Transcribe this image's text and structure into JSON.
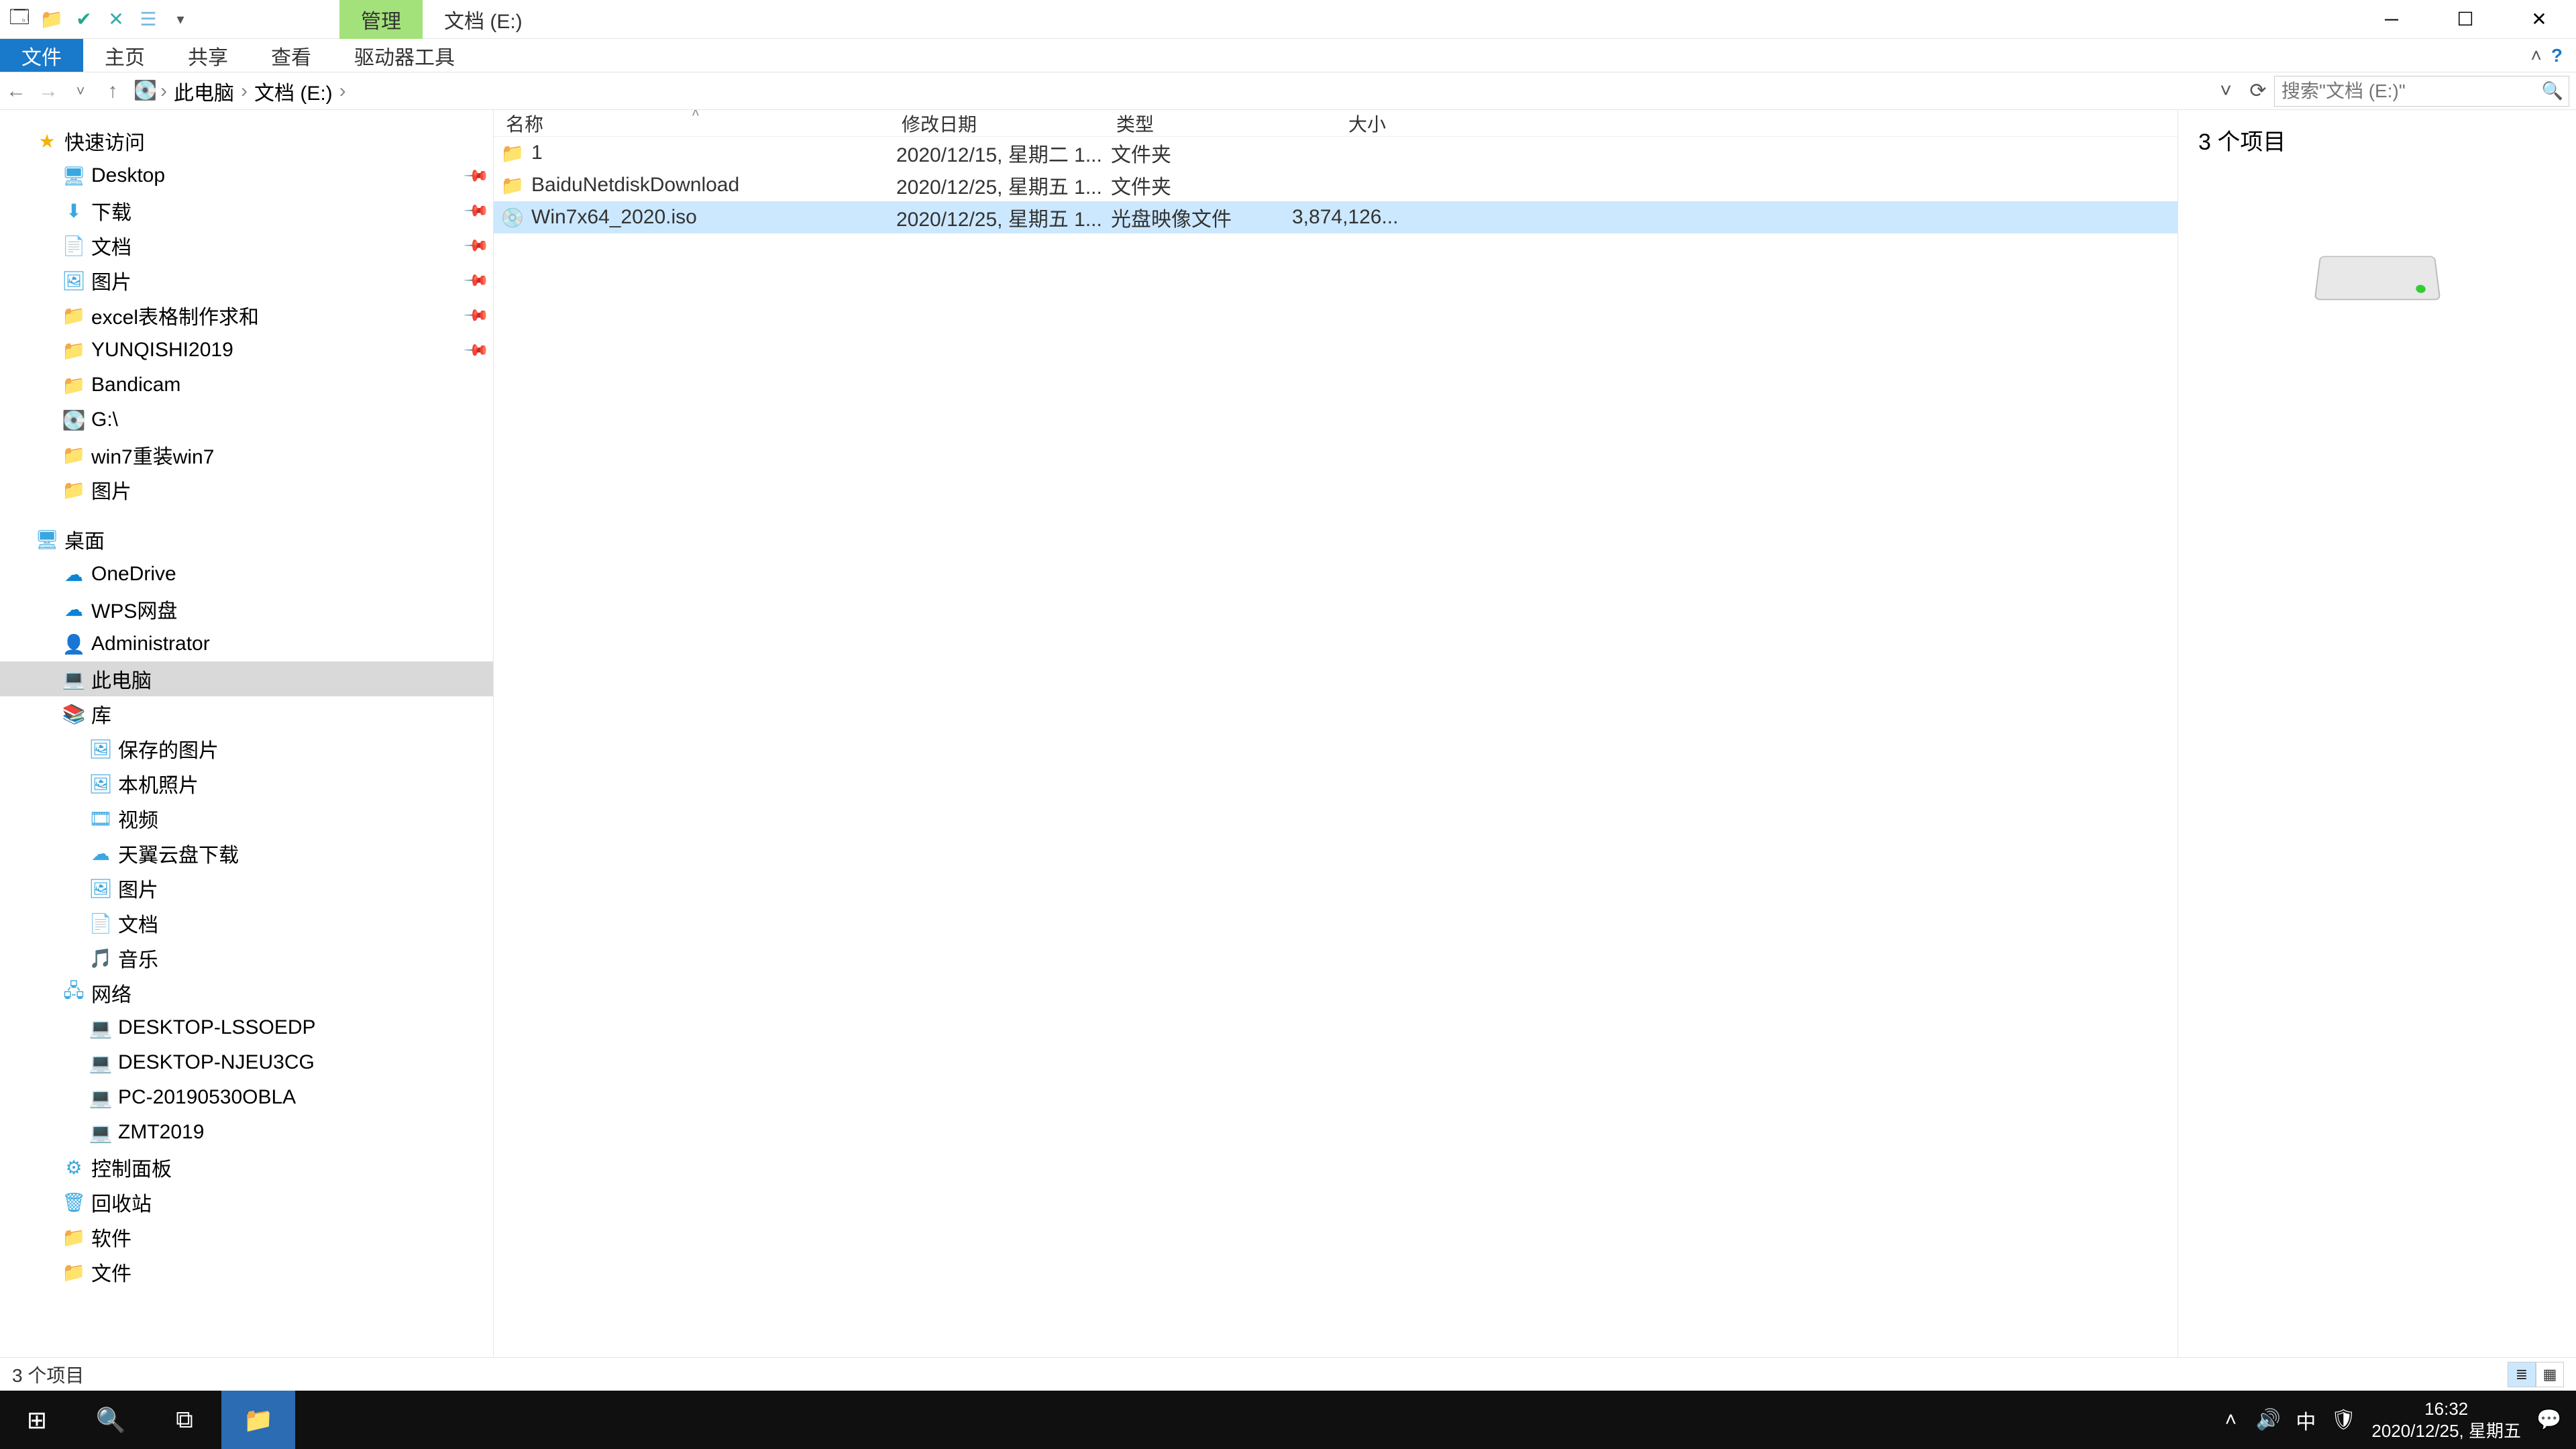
{
  "title_ctx_tab": "管理",
  "title_path_tab": "文档 (E:)",
  "ribbon": {
    "file": "文件",
    "home": "主页",
    "share": "共享",
    "view": "查看",
    "drive_tools": "驱动器工具"
  },
  "addr": {
    "c1": "此电脑",
    "c2": "文档 (E:)",
    "sep": "›",
    "search_placeholder": "搜索\"文档 (E:)\""
  },
  "cols": {
    "name": "名称",
    "date": "修改日期",
    "type": "类型",
    "size": "大小"
  },
  "files": [
    {
      "name": "1",
      "date": "2020/12/15, 星期二 1...",
      "type": "文件夹",
      "size": ""
    },
    {
      "name": "BaiduNetdiskDownload",
      "date": "2020/12/25, 星期五 1...",
      "type": "文件夹",
      "size": ""
    },
    {
      "name": "Win7x64_2020.iso",
      "date": "2020/12/25, 星期五 1...",
      "type": "光盘映像文件",
      "size": "3,874,126..."
    }
  ],
  "tree": {
    "quick": "快速访问",
    "quick_items": [
      "Desktop",
      "下载",
      "文档",
      "图片",
      "excel表格制作求和",
      "YUNQISHI2019",
      "Bandicam",
      "G:\\",
      "win7重装win7",
      "图片"
    ],
    "desktop": "桌面",
    "desktop_items": [
      "OneDrive",
      "WPS网盘",
      "Administrator",
      "此电脑",
      "库"
    ],
    "lib_items": [
      "保存的图片",
      "本机照片",
      "视频",
      "天翼云盘下载",
      "图片",
      "文档",
      "音乐"
    ],
    "network": "网络",
    "net_items": [
      "DESKTOP-LSSOEDP",
      "DESKTOP-NJEU3CG",
      "PC-20190530OBLA",
      "ZMT2019"
    ],
    "panel": "控制面板",
    "recycle": "回收站",
    "soft": "软件",
    "docs": "文件"
  },
  "preview_title": "3 个项目",
  "status": "3 个项目",
  "tray": {
    "ime": "中",
    "time": "16:32",
    "date": "2020/12/25, 星期五"
  }
}
